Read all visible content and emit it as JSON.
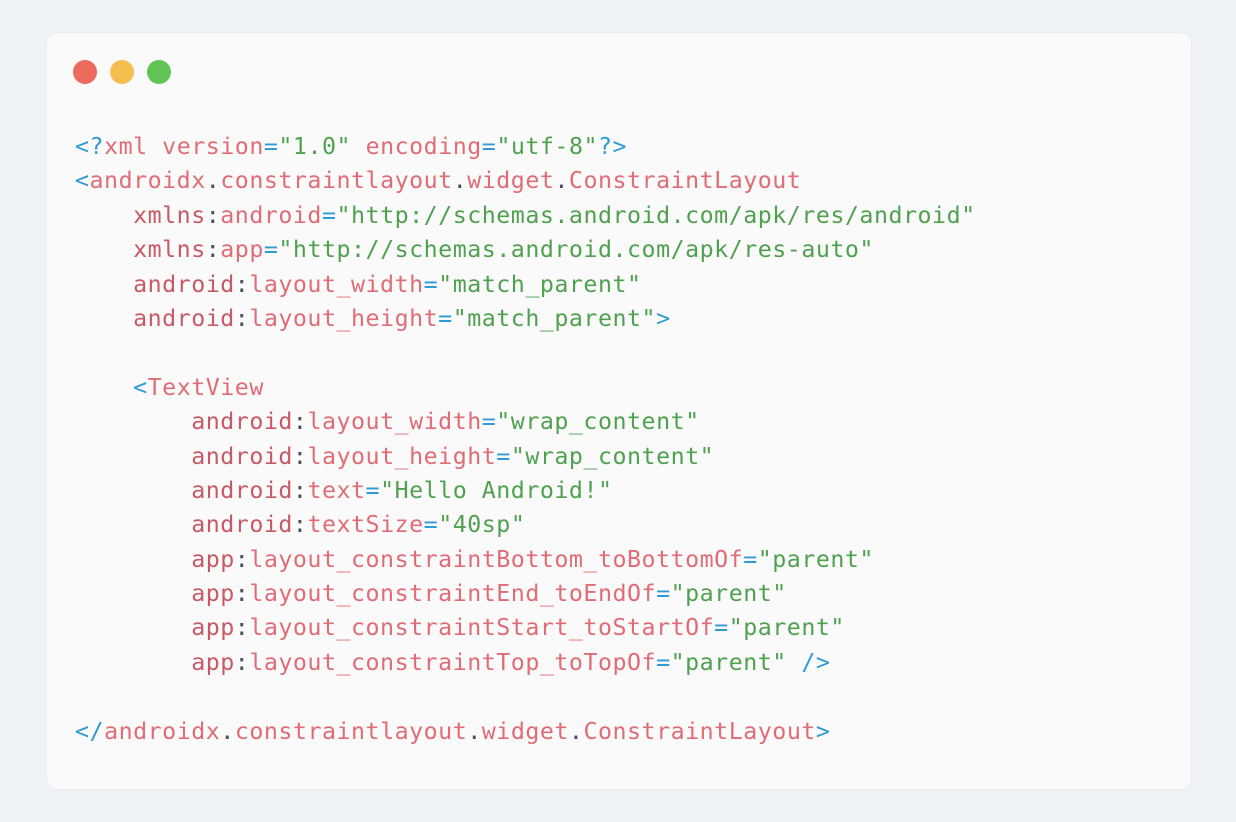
{
  "window": {
    "controls": {
      "close_color": "#ed6a5e",
      "minimize_color": "#f4bf4f",
      "maximize_color": "#61c454"
    }
  },
  "code": {
    "language": "xml",
    "lines": [
      [
        {
          "t": "<?",
          "c": "op"
        },
        {
          "t": "xml",
          "c": "tag"
        },
        {
          "t": " ",
          "c": "punct"
        },
        {
          "t": "version",
          "c": "attr"
        },
        {
          "t": "=",
          "c": "op"
        },
        {
          "t": "\"1.0\"",
          "c": "str"
        },
        {
          "t": " ",
          "c": "punct"
        },
        {
          "t": "encoding",
          "c": "attr"
        },
        {
          "t": "=",
          "c": "op"
        },
        {
          "t": "\"utf-8\"",
          "c": "str"
        },
        {
          "t": "?>",
          "c": "op"
        }
      ],
      [
        {
          "t": "<",
          "c": "op"
        },
        {
          "t": "androidx",
          "c": "tag"
        },
        {
          "t": ".",
          "c": "punct"
        },
        {
          "t": "constraintlayout",
          "c": "tag"
        },
        {
          "t": ".",
          "c": "punct"
        },
        {
          "t": "widget",
          "c": "tag"
        },
        {
          "t": ".",
          "c": "punct"
        },
        {
          "t": "ConstraintLayout",
          "c": "tag"
        }
      ],
      [
        {
          "t": "    ",
          "c": "punct"
        },
        {
          "t": "xmlns",
          "c": "ns"
        },
        {
          "t": ":",
          "c": "punct"
        },
        {
          "t": "android",
          "c": "attr"
        },
        {
          "t": "=",
          "c": "op"
        },
        {
          "t": "\"http://schemas.android.com/apk/res/android\"",
          "c": "str"
        }
      ],
      [
        {
          "t": "    ",
          "c": "punct"
        },
        {
          "t": "xmlns",
          "c": "ns"
        },
        {
          "t": ":",
          "c": "punct"
        },
        {
          "t": "app",
          "c": "attr"
        },
        {
          "t": "=",
          "c": "op"
        },
        {
          "t": "\"http://schemas.android.com/apk/res-auto\"",
          "c": "str"
        }
      ],
      [
        {
          "t": "    ",
          "c": "punct"
        },
        {
          "t": "android",
          "c": "ns"
        },
        {
          "t": ":",
          "c": "punct"
        },
        {
          "t": "layout_width",
          "c": "attr"
        },
        {
          "t": "=",
          "c": "op"
        },
        {
          "t": "\"match_parent\"",
          "c": "str"
        }
      ],
      [
        {
          "t": "    ",
          "c": "punct"
        },
        {
          "t": "android",
          "c": "ns"
        },
        {
          "t": ":",
          "c": "punct"
        },
        {
          "t": "layout_height",
          "c": "attr"
        },
        {
          "t": "=",
          "c": "op"
        },
        {
          "t": "\"match_parent\"",
          "c": "str"
        },
        {
          "t": ">",
          "c": "op"
        }
      ],
      [],
      [
        {
          "t": "    ",
          "c": "punct"
        },
        {
          "t": "<",
          "c": "op"
        },
        {
          "t": "TextView",
          "c": "tag"
        }
      ],
      [
        {
          "t": "        ",
          "c": "punct"
        },
        {
          "t": "android",
          "c": "ns"
        },
        {
          "t": ":",
          "c": "punct"
        },
        {
          "t": "layout_width",
          "c": "attr"
        },
        {
          "t": "=",
          "c": "op"
        },
        {
          "t": "\"wrap_content\"",
          "c": "str"
        }
      ],
      [
        {
          "t": "        ",
          "c": "punct"
        },
        {
          "t": "android",
          "c": "ns"
        },
        {
          "t": ":",
          "c": "punct"
        },
        {
          "t": "layout_height",
          "c": "attr"
        },
        {
          "t": "=",
          "c": "op"
        },
        {
          "t": "\"wrap_content\"",
          "c": "str"
        }
      ],
      [
        {
          "t": "        ",
          "c": "punct"
        },
        {
          "t": "android",
          "c": "ns"
        },
        {
          "t": ":",
          "c": "punct"
        },
        {
          "t": "text",
          "c": "attr"
        },
        {
          "t": "=",
          "c": "op"
        },
        {
          "t": "\"Hello Android!\"",
          "c": "str"
        }
      ],
      [
        {
          "t": "        ",
          "c": "punct"
        },
        {
          "t": "android",
          "c": "ns"
        },
        {
          "t": ":",
          "c": "punct"
        },
        {
          "t": "textSize",
          "c": "attr"
        },
        {
          "t": "=",
          "c": "op"
        },
        {
          "t": "\"40sp\"",
          "c": "str"
        }
      ],
      [
        {
          "t": "        ",
          "c": "punct"
        },
        {
          "t": "app",
          "c": "ns"
        },
        {
          "t": ":",
          "c": "punct"
        },
        {
          "t": "layout_constraintBottom_toBottomOf",
          "c": "attr"
        },
        {
          "t": "=",
          "c": "op"
        },
        {
          "t": "\"parent\"",
          "c": "str"
        }
      ],
      [
        {
          "t": "        ",
          "c": "punct"
        },
        {
          "t": "app",
          "c": "ns"
        },
        {
          "t": ":",
          "c": "punct"
        },
        {
          "t": "layout_constraintEnd_toEndOf",
          "c": "attr"
        },
        {
          "t": "=",
          "c": "op"
        },
        {
          "t": "\"parent\"",
          "c": "str"
        }
      ],
      [
        {
          "t": "        ",
          "c": "punct"
        },
        {
          "t": "app",
          "c": "ns"
        },
        {
          "t": ":",
          "c": "punct"
        },
        {
          "t": "layout_constraintStart_toStartOf",
          "c": "attr"
        },
        {
          "t": "=",
          "c": "op"
        },
        {
          "t": "\"parent\"",
          "c": "str"
        }
      ],
      [
        {
          "t": "        ",
          "c": "punct"
        },
        {
          "t": "app",
          "c": "ns"
        },
        {
          "t": ":",
          "c": "punct"
        },
        {
          "t": "layout_constraintTop_toTopOf",
          "c": "attr"
        },
        {
          "t": "=",
          "c": "op"
        },
        {
          "t": "\"parent\"",
          "c": "str"
        },
        {
          "t": " ",
          "c": "punct"
        },
        {
          "t": "/>",
          "c": "op"
        }
      ],
      [],
      [
        {
          "t": "</",
          "c": "op"
        },
        {
          "t": "androidx",
          "c": "tag"
        },
        {
          "t": ".",
          "c": "punct"
        },
        {
          "t": "constraintlayout",
          "c": "tag"
        },
        {
          "t": ".",
          "c": "punct"
        },
        {
          "t": "widget",
          "c": "tag"
        },
        {
          "t": ".",
          "c": "punct"
        },
        {
          "t": "ConstraintLayout",
          "c": "tag"
        },
        {
          "t": ">",
          "c": "op"
        }
      ]
    ]
  }
}
